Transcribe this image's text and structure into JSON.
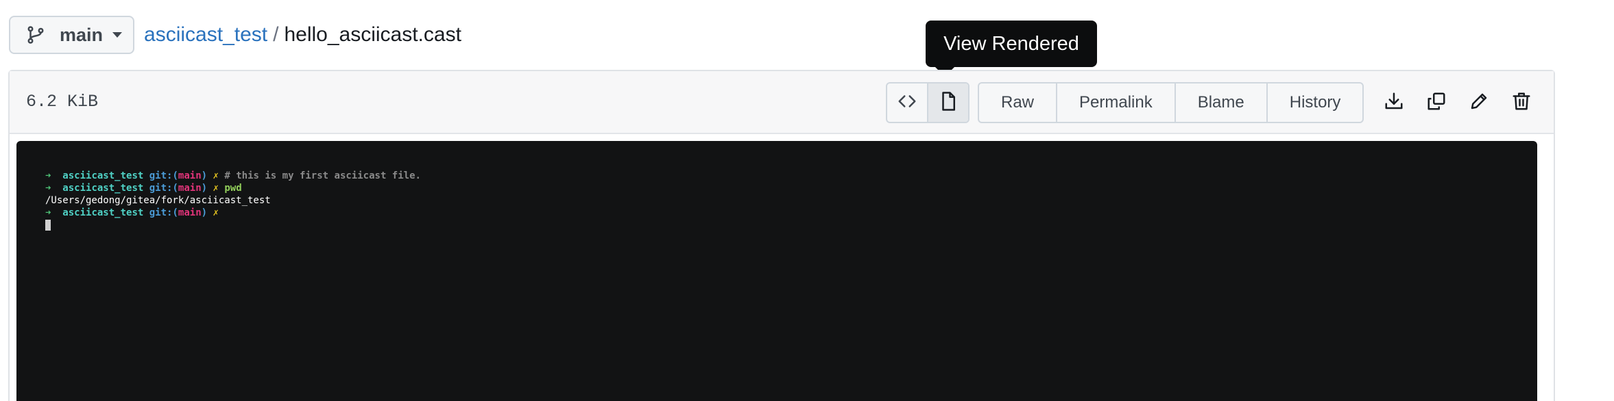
{
  "branch": {
    "label": "main",
    "icon": "git-branch-icon"
  },
  "breadcrumb": {
    "repo": "asciicast_test",
    "separator": "/",
    "file": "hello_asciicast.cast"
  },
  "tooltip": {
    "text": "View Rendered"
  },
  "file": {
    "size": "6.2 KiB"
  },
  "view_toggle": [
    {
      "name": "code-icon",
      "active": false
    },
    {
      "name": "file-icon",
      "active": true
    }
  ],
  "actions": {
    "raw": "Raw",
    "permalink": "Permalink",
    "blame": "Blame",
    "history": "History"
  },
  "icon_actions": [
    "download-icon",
    "copy-icon",
    "pencil-icon",
    "trash-icon"
  ],
  "terminal": {
    "lines": [
      {
        "arrow": "➜",
        "dir": "asciicast_test",
        "git": "git:(",
        "branch": "main",
        "git_close": ")",
        "x": "✗",
        "comment": "# this is my first asciicast file."
      },
      {
        "arrow": "➜",
        "dir": "asciicast_test",
        "git": "git:(",
        "branch": "main",
        "git_close": ")",
        "x": "✗",
        "cmd": "pwd"
      },
      {
        "output": "/Users/gedong/gitea/fork/asciicast_test"
      },
      {
        "arrow": "➜",
        "dir": "asciicast_test",
        "git": "git:(",
        "branch": "main",
        "git_close": ")",
        "x": "✗"
      }
    ]
  },
  "colors": {
    "link": "#2a72bd",
    "terminal_bg": "#121314",
    "tooltip_bg": "#0c0d0e"
  }
}
